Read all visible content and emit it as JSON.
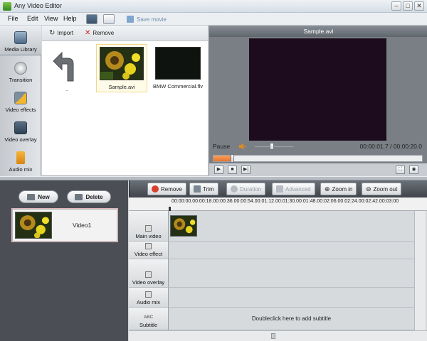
{
  "window": {
    "title": "Any Video Editor",
    "minimize": "–",
    "maximize": "□",
    "close": "✕"
  },
  "menu": {
    "items": [
      "File",
      "Edit",
      "View",
      "Help"
    ],
    "save_movie": "Save movie"
  },
  "sidebar": {
    "tabs": [
      {
        "label": "Media Library",
        "icon": "film-icon",
        "active": true
      },
      {
        "label": "Transition",
        "icon": "disc-icon"
      },
      {
        "label": "Video effects",
        "icon": "star-icon"
      },
      {
        "label": "Video overlay",
        "icon": "overlay-icon"
      },
      {
        "label": "Audio mix",
        "icon": "music-note-icon"
      }
    ]
  },
  "media": {
    "import_label": "Import",
    "remove_label": "Remove",
    "items": [
      {
        "caption": "..",
        "kind": "up-folder"
      },
      {
        "caption": "Sample.avi",
        "kind": "video",
        "selected": true
      },
      {
        "caption": "BMW Commercial.flv",
        "kind": "video"
      }
    ]
  },
  "preview": {
    "filename": "Sample.avi",
    "status": "Pause",
    "time": "00:00:01.7 / 00:00:20.0",
    "progress": 0.09,
    "volume": 0.45
  },
  "project": {
    "new_label": "New",
    "delete_label": "Delete",
    "items": [
      {
        "name": "Video1"
      }
    ]
  },
  "timeline": {
    "toolbar": {
      "remove": "Remove",
      "trim": "Trim",
      "duration": "Duration",
      "advanced": "Advanced",
      "zoom_in": "Zoom in",
      "zoom_out": "Zoom out"
    },
    "ruler": "00:00:00.00:00:18.00:00:36.00:00:54.00:01:12.00:01:30.00:01:48.00:02:06.00:02:24.00:02:42.00:03:00",
    "tracks": [
      "Main video",
      "Video effect",
      "Video overlay",
      "Audio mix",
      "Subtitle"
    ],
    "subtitle_prefix": "ABC",
    "subtitle_hint": "Doubleclick here to add subtitle"
  },
  "colors": {
    "accent_orange": "#e8742c",
    "dark_panel": "#4b4f55",
    "video_bg": "#1c0c1e"
  }
}
